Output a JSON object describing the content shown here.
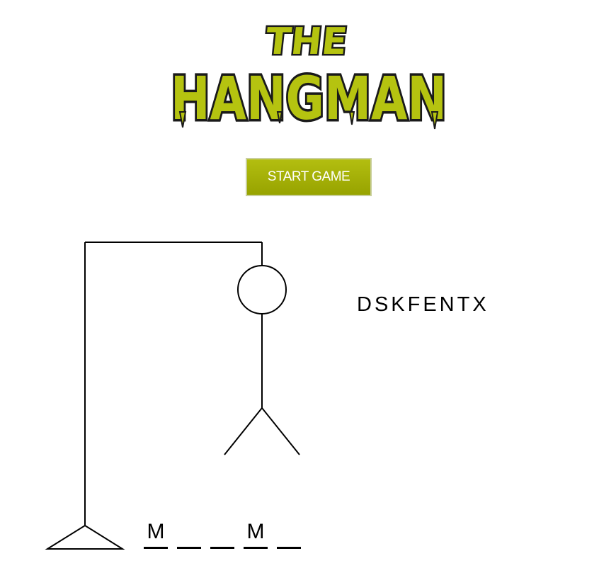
{
  "logo": {
    "line1": "THE",
    "line2": "HANGMAN",
    "fill_color": "#b5c310",
    "outline_color": "#1a1a1a"
  },
  "start_button": {
    "label": "START GAME",
    "color": "#a6b000"
  },
  "hangman": {
    "parts_drawn": [
      "base",
      "pole",
      "beam",
      "rope",
      "head",
      "body",
      "left-leg",
      "right-leg"
    ]
  },
  "guessed_letters": "DSKFENTX",
  "word_slots": [
    "M",
    "",
    "",
    "M",
    ""
  ]
}
